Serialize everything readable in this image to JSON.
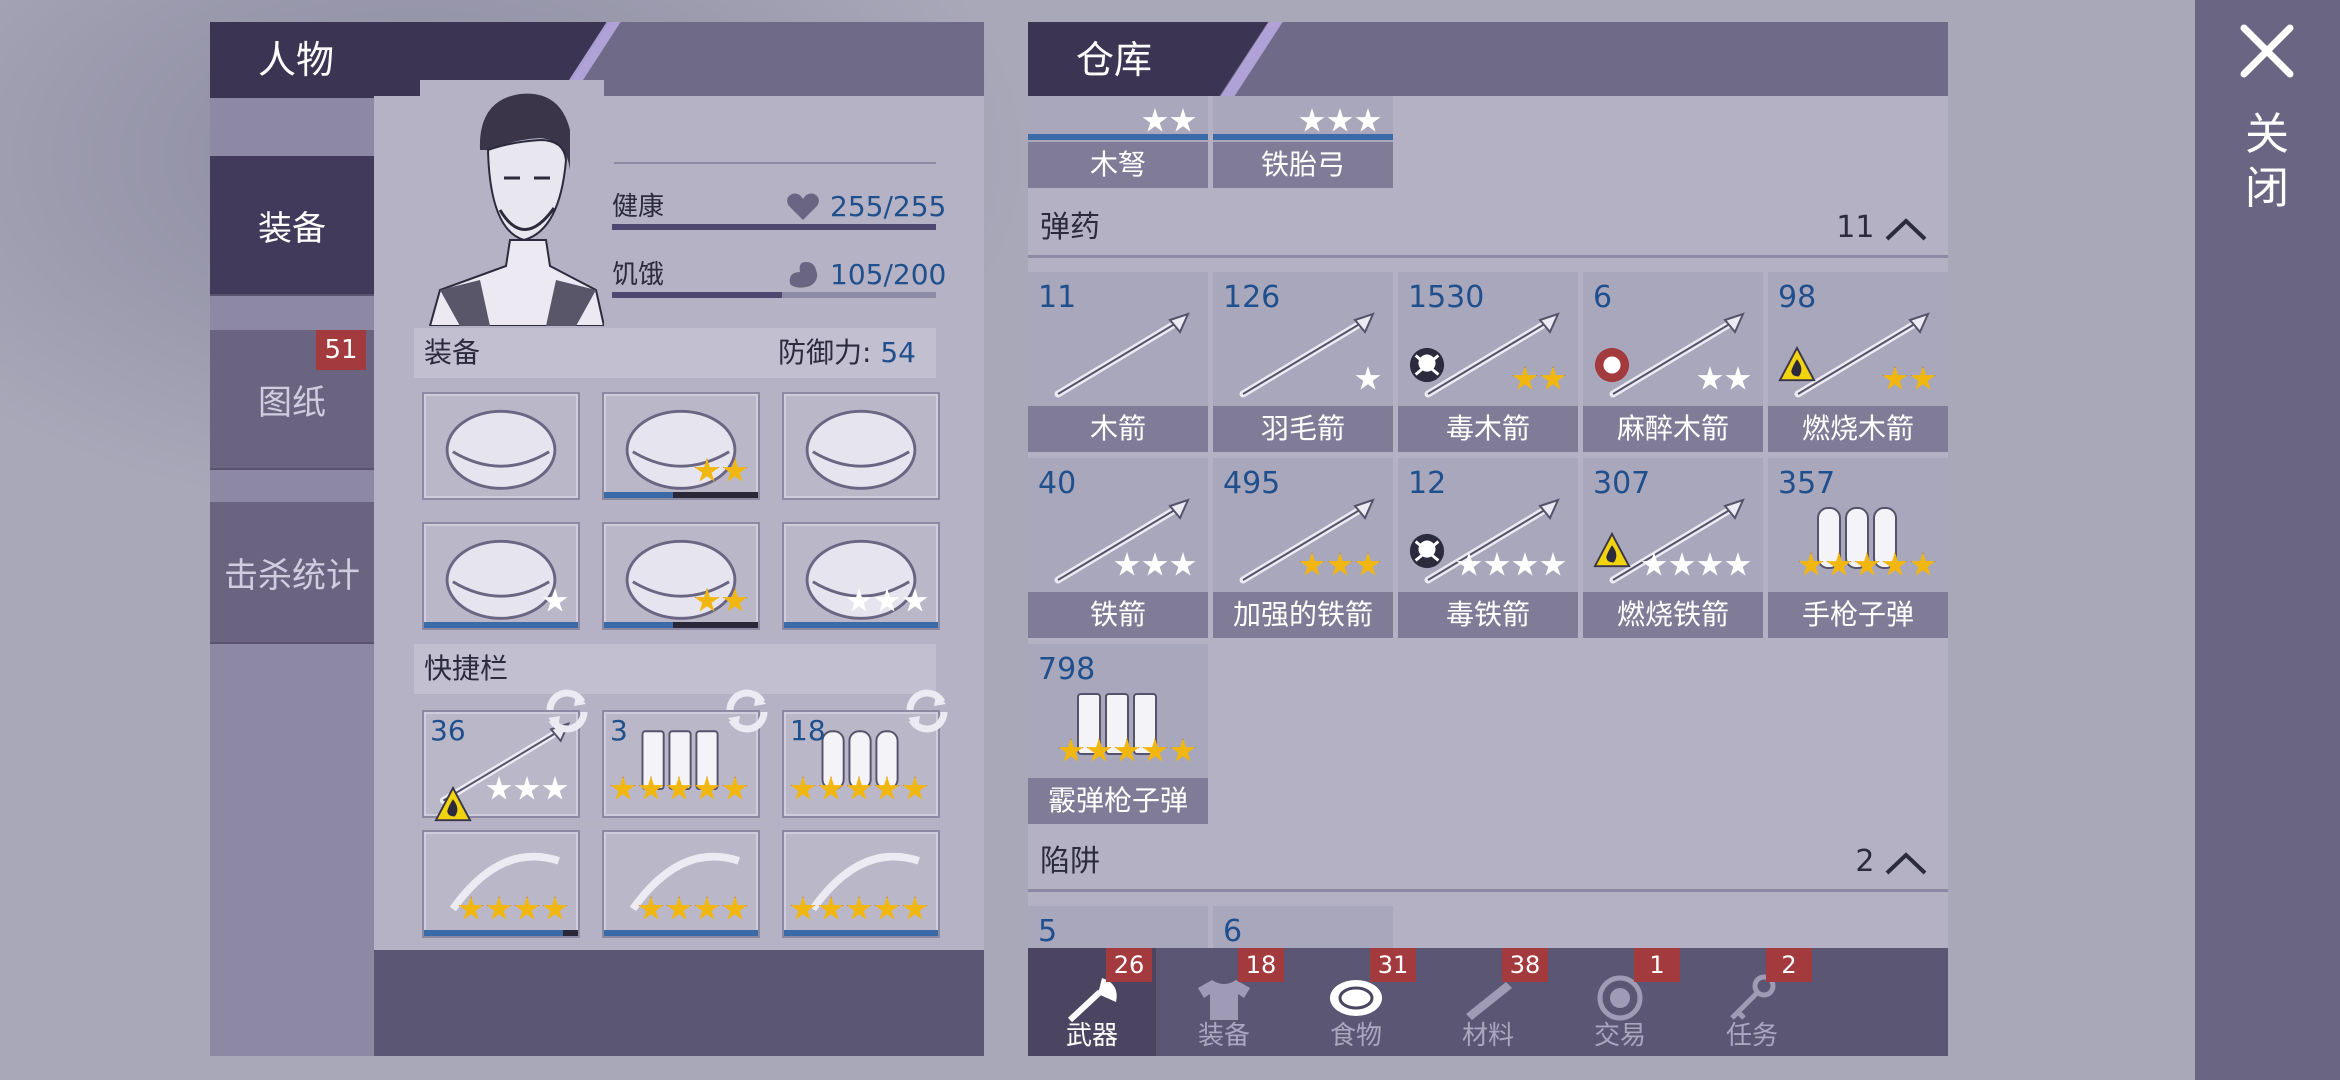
{
  "character": {
    "title": "人物",
    "side_tabs": [
      {
        "label": "装备",
        "active": true
      },
      {
        "label": "图纸",
        "badge": "51"
      },
      {
        "label": "击杀统计"
      }
    ],
    "stats": {
      "health_label": "健康",
      "health_value": "255/255",
      "health_fraction": 1.0,
      "hunger_label": "饥饿",
      "hunger_value": "105/200",
      "hunger_fraction": 0.525
    },
    "equipment": {
      "label": "装备",
      "defense_label": "防御力:",
      "defense_value": "54",
      "slots": [
        {
          "icon": "knit-hat-icon",
          "stars": []
        },
        {
          "icon": "chest-armor-icon",
          "stars": [
            "gold",
            "gold"
          ],
          "durability": 0.45
        },
        {
          "icon": "jacket-icon",
          "stars": []
        },
        {
          "icon": "gloves-icon",
          "stars": [
            "white"
          ],
          "durability": 1.0
        },
        {
          "icon": "armored-pants-icon",
          "stars": [
            "gold",
            "gold"
          ],
          "durability": 0.45
        },
        {
          "icon": "boots-icon",
          "stars": [
            "white",
            "white",
            "white"
          ],
          "durability": 1.0
        }
      ]
    },
    "quickbar": {
      "label": "快捷栏",
      "slots": [
        {
          "count": "36",
          "icon": "burning-iron-arrow-icon",
          "stars": [
            "white",
            "white",
            "white"
          ]
        },
        {
          "count": "3",
          "icon": "shotgun-shells-icon",
          "stars": [
            "gold",
            "gold",
            "gold",
            "gold",
            "gold"
          ]
        },
        {
          "count": "18",
          "icon": "pistol-bullets-icon",
          "stars": [
            "gold",
            "gold",
            "gold",
            "gold",
            "gold"
          ]
        },
        {
          "icon": "crossbow-icon",
          "stars": [
            "gold",
            "gold",
            "gold",
            "gold"
          ],
          "durability": 0.9
        },
        {
          "icon": "shotgun-icon",
          "stars": [
            "gold",
            "gold",
            "gold",
            "gold"
          ],
          "durability": 1.0
        },
        {
          "icon": "revolver-icon",
          "stars": [
            "gold",
            "gold",
            "gold",
            "gold",
            "gold"
          ],
          "durability": 1.0
        }
      ]
    }
  },
  "warehouse": {
    "title": "仓库",
    "top_items": [
      {
        "name": "木弩",
        "stars": [
          "white",
          "white"
        ]
      },
      {
        "name": "铁胎弓",
        "stars": [
          "white",
          "white",
          "white"
        ]
      }
    ],
    "ammo": {
      "label": "弹药",
      "count": "11",
      "items": [
        {
          "count": "11",
          "name": "木箭",
          "stars": []
        },
        {
          "count": "126",
          "name": "羽毛箭",
          "stars": [
            "white"
          ]
        },
        {
          "count": "1530",
          "name": "毒木箭",
          "stars": [
            "gold",
            "gold"
          ],
          "effect": "poison"
        },
        {
          "count": "6",
          "name": "麻醉木箭",
          "stars": [
            "white",
            "white"
          ],
          "effect": "sedative"
        },
        {
          "count": "98",
          "name": "燃烧木箭",
          "stars": [
            "gold",
            "gold"
          ],
          "effect": "fire"
        },
        {
          "count": "40",
          "name": "铁箭",
          "stars": [
            "white",
            "white",
            "white"
          ]
        },
        {
          "count": "495",
          "name": "加强的铁箭",
          "stars": [
            "gold",
            "gold",
            "gold"
          ]
        },
        {
          "count": "12",
          "name": "毒铁箭",
          "stars": [
            "white",
            "white",
            "white",
            "white"
          ],
          "effect": "poison"
        },
        {
          "count": "307",
          "name": "燃烧铁箭",
          "stars": [
            "white",
            "white",
            "white",
            "white"
          ],
          "effect": "fire"
        },
        {
          "count": "357",
          "name": "手枪子弹",
          "stars": [
            "gold",
            "gold",
            "gold",
            "gold",
            "gold"
          ],
          "kind": "bullets"
        },
        {
          "count": "798",
          "name": "霰弹枪子弹",
          "stars": [
            "gold",
            "gold",
            "gold",
            "gold",
            "gold"
          ],
          "kind": "shells"
        }
      ]
    },
    "traps": {
      "label": "陷阱",
      "count": "2",
      "items": [
        {
          "count": "5"
        },
        {
          "count": "6"
        }
      ]
    },
    "bottom_tabs": [
      {
        "label": "武器",
        "badge": "26",
        "active": true,
        "icon": "axe-icon"
      },
      {
        "label": "装备",
        "badge": "18",
        "icon": "shirt-icon"
      },
      {
        "label": "食物",
        "badge": "31",
        "icon": "meat-icon"
      },
      {
        "label": "材料",
        "badge": "38",
        "icon": "wood-icon"
      },
      {
        "label": "交易",
        "badge": "1",
        "icon": "coin-icon"
      },
      {
        "label": "任务",
        "badge": "2",
        "icon": "key-icon"
      }
    ]
  },
  "close": {
    "label": "关闭"
  },
  "colors": {
    "gold_star": "#f2b70f",
    "badge_red": "#a33a3e",
    "count_blue": "#1f4f8c",
    "durability_blue": "#3b6aa8"
  }
}
